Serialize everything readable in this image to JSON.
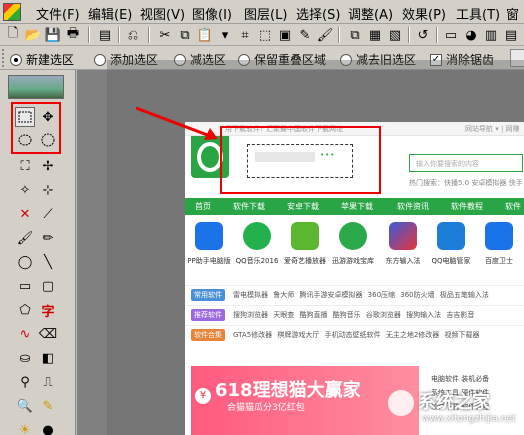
{
  "menubar": {
    "items": [
      "文件(F)",
      "编辑(E)",
      "视图(V)",
      "图像(I)",
      "图层(L)",
      "选择(S)",
      "调整(A)",
      "效果(P)",
      "工具(T)",
      "窗"
    ]
  },
  "optbar": {
    "options": [
      {
        "label": "新建选区",
        "selected": true
      },
      {
        "label": "添加选区",
        "selected": false
      },
      {
        "label": "减选区",
        "selected": false
      },
      {
        "label": "保留重叠区域",
        "selected": false
      },
      {
        "label": "减去旧选区",
        "selected": false
      }
    ],
    "antialias_label": "消除锯齿",
    "antialias_checked": true,
    "antialias_mark": "✓"
  },
  "tools": {
    "glyph_1": "字"
  },
  "webpage": {
    "topstrip_left": "用下载软件? 汇聚最中国软件下载网址",
    "topstrip_right": "网站导航 ▾ | 网赚",
    "search_placeholder": "输入你要搜索的内容",
    "hot_search": "热门搜索：快播5.0  安卓模拟器  快手",
    "green_dots": "•••",
    "nav": [
      "首页",
      "软件下载",
      "安卓下载",
      "苹果下载",
      "软件资讯",
      "软件教程",
      "软件"
    ],
    "apps": [
      {
        "label": "PP助手电脑版",
        "color": "#1a73e8"
      },
      {
        "label": "QQ音乐2016",
        "color": "#22b14c"
      },
      {
        "label": "爱奇艺播放器",
        "color": "#5ab72f"
      },
      {
        "label": "迅游游戏宝库",
        "color": "#2ba84a"
      },
      {
        "label": "东方输入法",
        "color": "#3b5bdb"
      },
      {
        "label": "QQ电脑管家",
        "color": "#1c7ed6"
      },
      {
        "label": "百度卫士",
        "color": "#1a73e8"
      }
    ],
    "categories": [
      {
        "tag": "常用软件",
        "color": "#4a90d9",
        "links": "雷电模拟器  鲁大师  腾讯手游安卓模拟器  360压缩  360防火墙  极品五笔输入法"
      },
      {
        "tag": "推荐软件",
        "color": "#9c6ade",
        "links": "搜狗浏览器  天眼查  酷狗直播  酷狗音乐  谷歌浏览器  搜狗输入法  吉吉影音"
      },
      {
        "tag": "软件合集",
        "color": "#e8833a",
        "links": "GTA5修改器  棋牌游戏大厅  手机动态壁纸软件  无主之地2修改器  视频下载器"
      }
    ],
    "banner_title": "618理想猫大赢家",
    "banner_sub": "合猫猫瓜分3亿红包",
    "banner_coin": "¥",
    "side_links": [
      "电脑软件  装机必备",
      "系统工具  硬件软件",
      "软件下载  软件教程"
    ]
  },
  "watermark": {
    "text": "系统之家",
    "url": "www.xitongzhijia.net"
  }
}
